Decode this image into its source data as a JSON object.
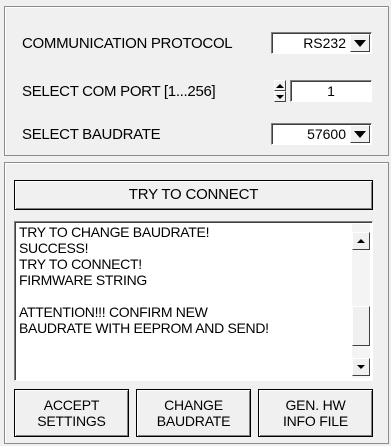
{
  "settings": {
    "protocol_label": "COMMUNICATION PROTOCOL",
    "protocol_value": "RS232",
    "com_port_label": "SELECT COM PORT [1...256]",
    "com_port_value": "1",
    "baudrate_label": "SELECT BAUDRATE",
    "baudrate_value": "57600"
  },
  "connect": {
    "try_connect_label": "TRY TO CONNECT",
    "log_lines": [
      "TRY TO CHANGE BAUDRATE!",
      "SUCCESS!",
      "TRY TO CONNECT!",
      "FIRMWARE STRING",
      "",
      "ATTENTION!!!  CONFIRM NEW",
      "BAUDRATE WITH EEPROM AND SEND!"
    ]
  },
  "buttons": {
    "accept_line1": "ACCEPT",
    "accept_line2": "SETTINGS",
    "change_line1": "CHANGE",
    "change_line2": "BAUDRATE",
    "genhw_line1": "GEN. HW",
    "genhw_line2": "INFO FILE"
  },
  "icons": {
    "dropdown": "chevron-down-icon",
    "spin": "spin-arrows-icon",
    "scroll_up": "arrow-up-icon",
    "scroll_down": "arrow-down-icon"
  }
}
